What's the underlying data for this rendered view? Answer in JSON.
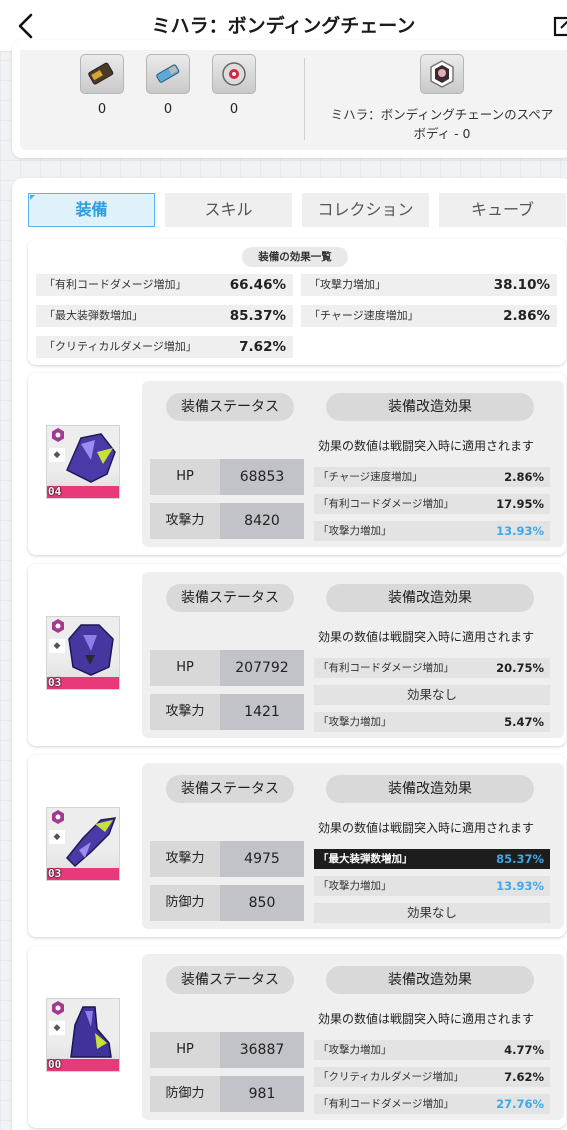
{
  "header": {
    "title": "ミハラ：ボンディングチェーン"
  },
  "materials": {
    "items": [
      {
        "icon": "bullet-battery-icon",
        "count": "0"
      },
      {
        "icon": "usb-chip-icon",
        "count": "0"
      },
      {
        "icon": "red-core-orb-icon",
        "count": "0"
      }
    ],
    "spare_body_label": "ミハラ：ボンディングチェーンのスペアボディ - 0"
  },
  "tabs": [
    {
      "label": "装備",
      "active": true
    },
    {
      "label": "スキル",
      "active": false
    },
    {
      "label": "コレクション",
      "active": false
    },
    {
      "label": "キューブ",
      "active": false
    }
  ],
  "effects_summary": {
    "title": "装備の効果一覧",
    "items": [
      {
        "label": "「有利コードダメージ増加」",
        "value": "66.46%"
      },
      {
        "label": "「攻撃力増加」",
        "value": "38.10%"
      },
      {
        "label": "「最大装弾数増加」",
        "value": "85.37%"
      },
      {
        "label": "「チャージ速度増加」",
        "value": "2.86%"
      },
      {
        "label": "「クリティカルダメージ増加」",
        "value": "7.62%"
      }
    ]
  },
  "equipment_common": {
    "status_label": "装備ステータス",
    "mod_label": "装備改造効果",
    "note": "効果の数値は戦闘突入時に適用されます",
    "no_effect": "効果なし"
  },
  "equipment": [
    {
      "name": "head-gear",
      "level": "04",
      "stats": [
        {
          "k": "HP",
          "v": "68853"
        },
        {
          "k": "攻撃力",
          "v": "8420"
        }
      ],
      "mods": [
        {
          "label": "「チャージ速度増加」",
          "value": "2.86%",
          "style": "normal"
        },
        {
          "label": "「有利コードダメージ増加」",
          "value": "17.95%",
          "style": "normal"
        },
        {
          "label": "「攻撃力増加」",
          "value": "13.93%",
          "style": "blue"
        }
      ]
    },
    {
      "name": "body-gear",
      "level": "03",
      "stats": [
        {
          "k": "HP",
          "v": "207792"
        },
        {
          "k": "攻撃力",
          "v": "1421"
        }
      ],
      "mods": [
        {
          "label": "「有利コードダメージ増加」",
          "value": "20.75%",
          "style": "normal"
        },
        {
          "label": "",
          "value": "",
          "style": "none"
        },
        {
          "label": "「攻撃力増加」",
          "value": "5.47%",
          "style": "normal"
        }
      ]
    },
    {
      "name": "arm-gear",
      "level": "03",
      "stats": [
        {
          "k": "攻撃力",
          "v": "4975"
        },
        {
          "k": "防御力",
          "v": "850"
        }
      ],
      "mods": [
        {
          "label": "「最大装弾数増加」",
          "value": "85.37%",
          "style": "dark"
        },
        {
          "label": "「攻撃力増加」",
          "value": "13.93%",
          "style": "blue"
        },
        {
          "label": "",
          "value": "",
          "style": "none"
        }
      ]
    },
    {
      "name": "leg-gear",
      "level": "00",
      "stats": [
        {
          "k": "HP",
          "v": "36887"
        },
        {
          "k": "防御力",
          "v": "981"
        }
      ],
      "mods": [
        {
          "label": "「攻撃力増加」",
          "value": "4.77%",
          "style": "normal"
        },
        {
          "label": "「クリティカルダメージ増加」",
          "value": "7.62%",
          "style": "normal"
        },
        {
          "label": "「有利コードダメージ増加」",
          "value": "27.76%",
          "style": "blue"
        }
      ]
    }
  ]
}
